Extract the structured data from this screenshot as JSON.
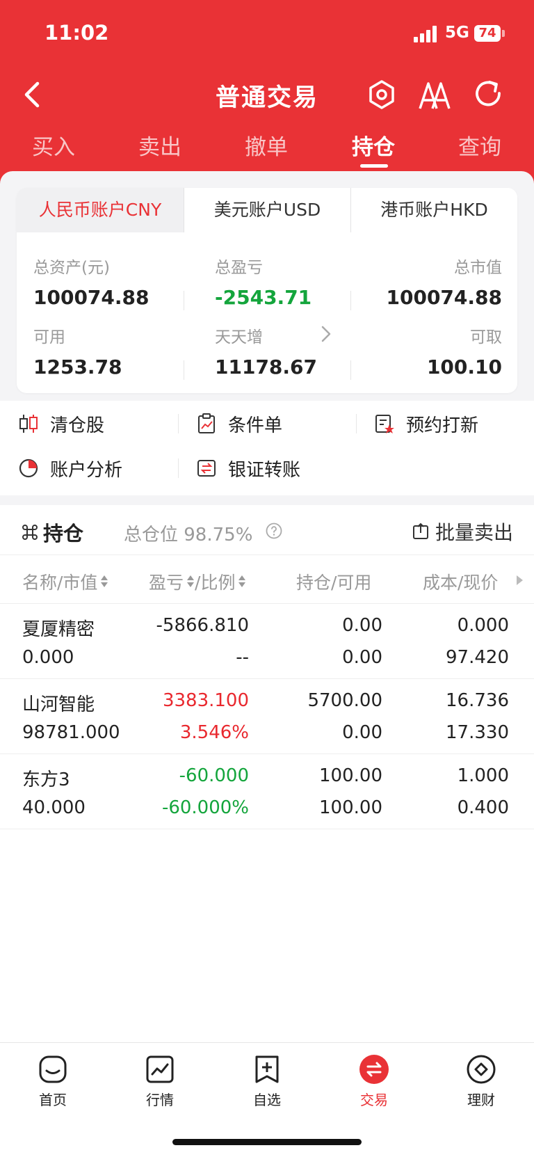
{
  "status": {
    "time": "11:02",
    "network": "5G",
    "battery": "74"
  },
  "nav": {
    "title": "普通交易"
  },
  "tabs": [
    {
      "label": "买入"
    },
    {
      "label": "卖出"
    },
    {
      "label": "撤单"
    },
    {
      "label": "持仓",
      "active": true
    },
    {
      "label": "查询"
    }
  ],
  "accounts": {
    "tabs": [
      {
        "label": "人民币账户CNY",
        "active": true
      },
      {
        "label": "美元账户USD"
      },
      {
        "label": "港币账户HKD"
      }
    ],
    "total_assets_label": "总资产(元)",
    "total_assets": "100074.88",
    "total_pnl_label": "总盈亏",
    "total_pnl": "-2543.71",
    "market_value_label": "总市值",
    "market_value": "100074.88",
    "available_label": "可用",
    "available": "1253.78",
    "tiantianzeng_label": "天天增",
    "tiantianzeng": "11178.67",
    "withdrawable_label": "可取",
    "withdrawable": "100.10"
  },
  "quick_actions": [
    {
      "label": "清仓股",
      "icon": "candlestick-icon"
    },
    {
      "label": "条件单",
      "icon": "clipboard-chart-icon"
    },
    {
      "label": "预约打新",
      "icon": "document-star-icon"
    },
    {
      "label": "账户分析",
      "icon": "pie-chart-icon"
    },
    {
      "label": "银证转账",
      "icon": "transfer-icon"
    }
  ],
  "holdings": {
    "title": "持仓",
    "position_label": "总仓位 98.75%",
    "batch_sell": "批量卖出",
    "columns": {
      "name": "名称/市值",
      "pnl": "盈亏",
      "ratio": "/比例",
      "position": "持仓/可用",
      "cost": "成本/现价"
    },
    "rows": [
      {
        "name": "夏厦精密",
        "value": "0.000",
        "pnl": "-5866.810",
        "ratio": "--",
        "hold": "0.00",
        "avail": "0.00",
        "cost": "0.000",
        "price": "97.420",
        "color": "#222222"
      },
      {
        "name": "山河智能",
        "value": "98781.000",
        "pnl": "3383.100",
        "ratio": "3.546%",
        "hold": "5700.00",
        "avail": "0.00",
        "cost": "16.736",
        "price": "17.330",
        "color": "#e9282e"
      },
      {
        "name": "东方3",
        "value": "40.000",
        "pnl": "-60.000",
        "ratio": "-60.000%",
        "hold": "100.00",
        "avail": "100.00",
        "cost": "1.000",
        "price": "0.400",
        "color": "#14a53c"
      }
    ]
  },
  "bottom_nav": [
    {
      "label": "首页"
    },
    {
      "label": "行情"
    },
    {
      "label": "自选"
    },
    {
      "label": "交易",
      "active": true
    },
    {
      "label": "理财"
    }
  ],
  "colors": {
    "brand": "#e93236",
    "up": "#e9282e",
    "down": "#14a53c"
  }
}
